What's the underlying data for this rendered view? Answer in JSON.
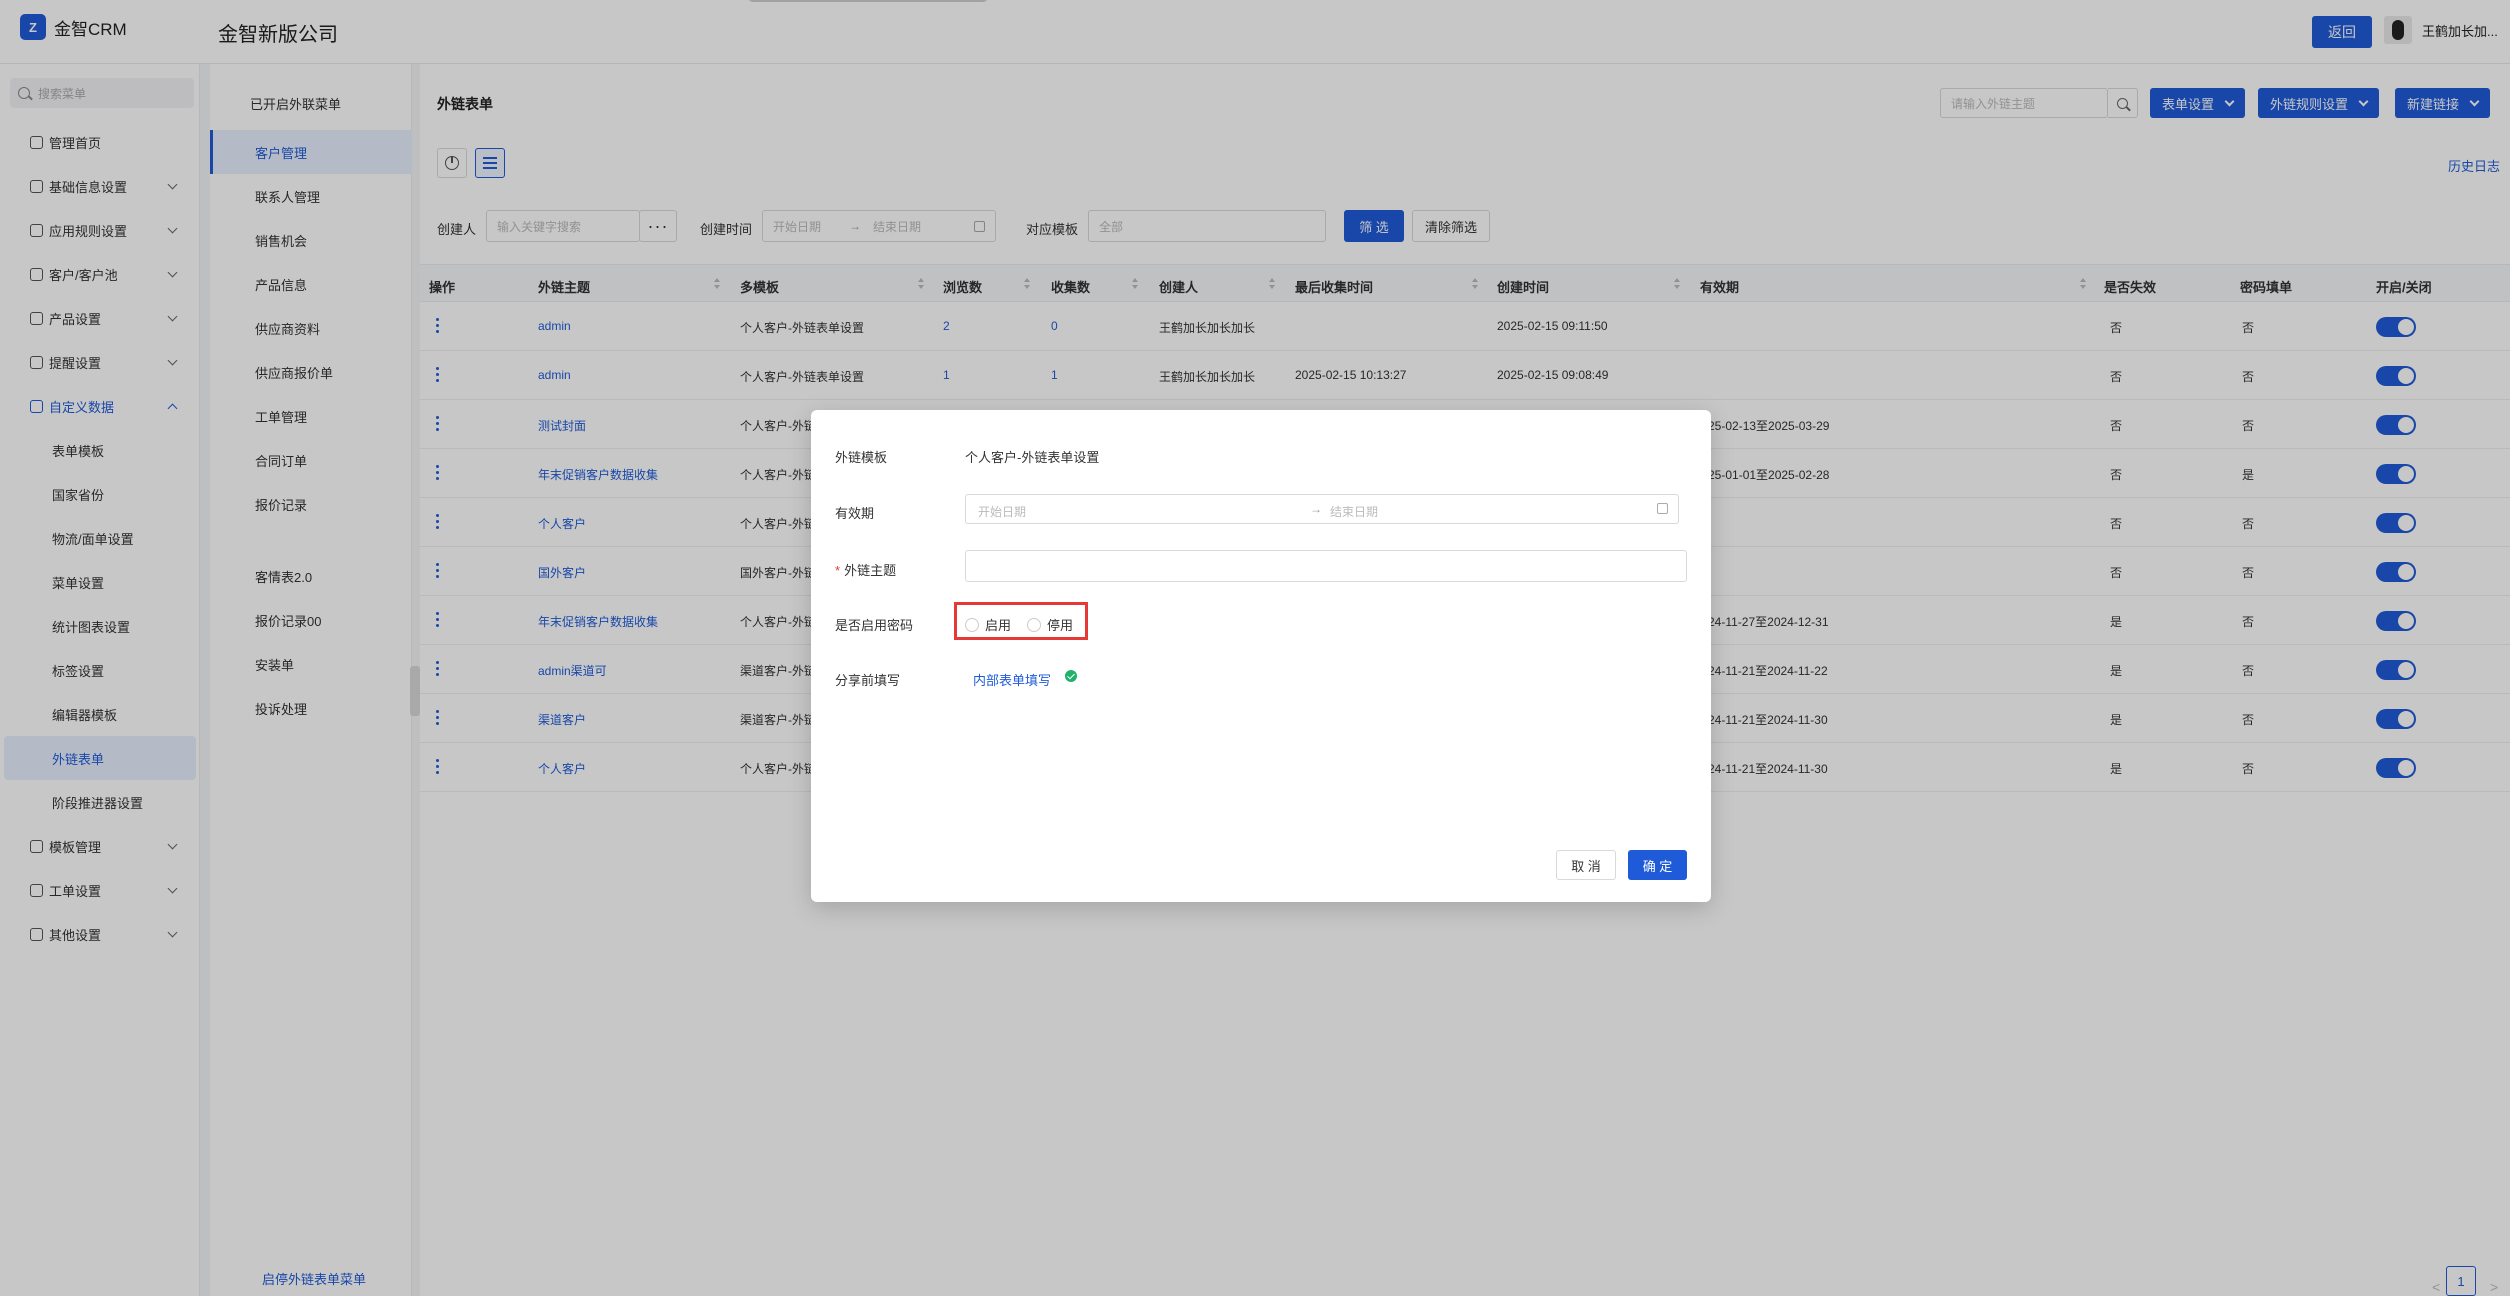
{
  "app": {
    "logo_mark": "Z",
    "name": "金智CRM",
    "company": "金智新版公司",
    "back_label": "返回",
    "user_name": "王鹤加长加..."
  },
  "sidebar": {
    "search_placeholder": "搜索菜单",
    "items": [
      {
        "label": "管理首页",
        "icon": "home-icon",
        "chevron": false
      },
      {
        "label": "基础信息设置",
        "icon": "settings-icon",
        "chevron": true
      },
      {
        "label": "应用规则设置",
        "icon": "rules-icon",
        "chevron": true
      },
      {
        "label": "客户/客户池",
        "icon": "customer-icon",
        "chevron": true
      },
      {
        "label": "产品设置",
        "icon": "product-icon",
        "chevron": true
      },
      {
        "label": "提醒设置",
        "icon": "bell-icon",
        "chevron": true
      },
      {
        "label": "自定义数据",
        "icon": "custom-data-icon",
        "chevron": true,
        "open": true
      }
    ],
    "sub_items": [
      "表单模板",
      "国家省份",
      "物流/面单设置",
      "菜单设置",
      "统计图表设置",
      "标签设置",
      "编辑器模板",
      "外链表单",
      "阶段推进器设置"
    ],
    "active_sub": "外链表单",
    "bottom_items": [
      {
        "label": "模板管理",
        "icon": "template-icon"
      },
      {
        "label": "工单设置",
        "icon": "workorder-icon"
      },
      {
        "label": "其他设置",
        "icon": "grid-icon"
      }
    ]
  },
  "menu2": {
    "header": "已开启外联菜单",
    "items": [
      "客户管理",
      "联系人管理",
      "销售机会",
      "产品信息",
      "供应商资料",
      "供应商报价单",
      "工单管理",
      "合同订单",
      "报价记录"
    ],
    "items2": [
      "客情表2.0",
      "报价记录00",
      "安装单",
      "投诉处理"
    ],
    "active": "客户管理",
    "footer": "启停外链表单菜单"
  },
  "content": {
    "title": "外链表单",
    "search_placeholder": "请输入外链主题",
    "buttons": [
      "表单设置",
      "外链规则设置",
      "新建链接"
    ],
    "history_link": "历史日志",
    "filters": {
      "creator_label": "创建人",
      "creator_placeholder": "输入关键字搜索",
      "created_label": "创建时间",
      "start_placeholder": "开始日期",
      "end_placeholder": "结束日期",
      "template_label": "对应模板",
      "template_value": "全部",
      "filter_btn": "筛 选",
      "clear_btn": "清除筛选"
    },
    "columns": [
      "操作",
      "外链主题",
      "多模板",
      "浏览数",
      "收集数",
      "创建人",
      "最后收集时间",
      "创建时间",
      "有效期",
      "是否失效",
      "密码填单",
      "开启/关闭"
    ],
    "rows": [
      {
        "topic": "admin",
        "template": "个人客户-外链表单设置",
        "views": "2",
        "collected": "0",
        "creator": "王鹤加长加长加长",
        "last": "",
        "created": "2025-02-15 09:11:50",
        "validity": "",
        "expired": "否",
        "pwd": "否"
      },
      {
        "topic": "admin",
        "template": "个人客户-外链表单设置",
        "views": "1",
        "collected": "1",
        "creator": "王鹤加长加长加长",
        "last": "2025-02-15 10:13:27",
        "created": "2025-02-15 09:08:49",
        "validity": "",
        "expired": "否",
        "pwd": "否"
      },
      {
        "topic": "测试封面",
        "template": "个人客户-外链",
        "views": "",
        "collected": "",
        "creator": "",
        "last": "",
        "created": "",
        "validity": "25-02-13至2025-03-29",
        "expired": "否",
        "pwd": "否"
      },
      {
        "topic": "年末促销客户数据收集",
        "template": "个人客户-外链",
        "views": "",
        "collected": "",
        "creator": "",
        "last": "",
        "created": "",
        "validity": "25-01-01至2025-02-28",
        "expired": "否",
        "pwd": "是"
      },
      {
        "topic": "个人客户",
        "template": "个人客户-外链",
        "views": "",
        "collected": "",
        "creator": "",
        "last": "",
        "created": "",
        "validity": "",
        "expired": "否",
        "pwd": "否"
      },
      {
        "topic": "国外客户",
        "template": "国外客户-外链",
        "views": "",
        "collected": "",
        "creator": "",
        "last": "",
        "created": "",
        "validity": "",
        "expired": "否",
        "pwd": "否"
      },
      {
        "topic": "年末促销客户数据收集",
        "template": "个人客户-外链",
        "views": "",
        "collected": "",
        "creator": "",
        "last": "",
        "created": "",
        "validity": "24-11-27至2024-12-31",
        "expired": "是",
        "pwd": "否"
      },
      {
        "topic": "admin渠道可",
        "template": "渠道客户-外链",
        "views": "",
        "collected": "",
        "creator": "",
        "last": "",
        "created": "",
        "validity": "24-11-21至2024-11-22",
        "expired": "是",
        "pwd": "否"
      },
      {
        "topic": "渠道客户",
        "template": "渠道客户-外链",
        "views": "",
        "collected": "",
        "creator": "",
        "last": "",
        "created": "",
        "validity": "24-11-21至2024-11-30",
        "expired": "是",
        "pwd": "否"
      },
      {
        "topic": "个人客户",
        "template": "个人客户-外链",
        "views": "",
        "collected": "",
        "creator": "",
        "last": "",
        "created": "",
        "validity": "24-11-21至2024-11-30",
        "expired": "是",
        "pwd": "否"
      }
    ],
    "pager": {
      "prev": "<",
      "current": "1",
      "next": ">"
    }
  },
  "modal": {
    "template_label": "外链模板",
    "template_value": "个人客户-外链表单设置",
    "validity_label": "有效期",
    "start_placeholder": "开始日期",
    "end_placeholder": "结束日期",
    "topic_label": "外链主题",
    "topic_value": "",
    "password_label": "是否启用密码",
    "radio_enable": "启用",
    "radio_disable": "停用",
    "share_label": "分享前填写",
    "share_link": "内部表单填写",
    "cancel": "取 消",
    "ok": "确 定"
  },
  "colors": {
    "primary": "#1f5bd9",
    "highlight": "#e53935",
    "success": "#20b26b"
  }
}
